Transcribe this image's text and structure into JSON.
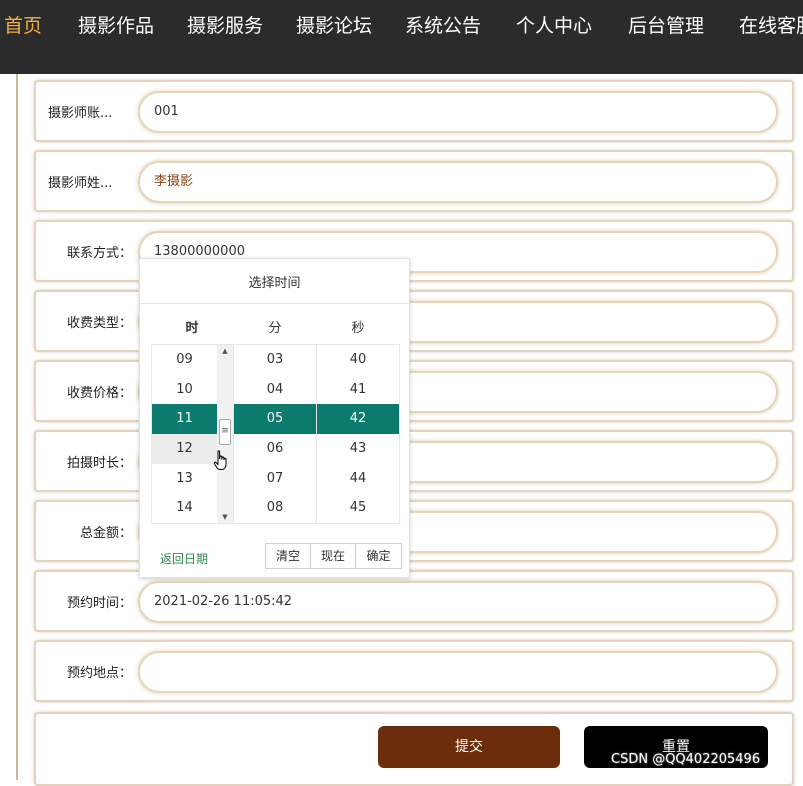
{
  "nav": {
    "items": [
      "首页",
      "摄影作品",
      "摄影服务",
      "摄影论坛",
      "系统公告",
      "个人中心",
      "后台管理",
      "在线客服"
    ],
    "active_color": "#f5b041"
  },
  "form": {
    "rows": [
      {
        "label": "摄影师账...",
        "value": ""
      },
      {
        "label": "摄影师姓...",
        "value": ""
      },
      {
        "label": "联系方式：",
        "value": ""
      },
      {
        "label": "收费类型：",
        "value": ""
      },
      {
        "label": "收费价格：",
        "value": ""
      },
      {
        "label": "拍摄时长：",
        "value": ""
      },
      {
        "label": "总金额：",
        "value": ""
      },
      {
        "label": "预约时间：",
        "value": ""
      },
      {
        "label": "预约地点：",
        "value": ""
      }
    ],
    "account_value": "001",
    "name_value": "李摄影",
    "phone_value": "13800000000",
    "appointment_value": "2021-02-26 11:05:42",
    "submit_label": "提交",
    "reset_label": "重置"
  },
  "picker": {
    "title": "选择时间",
    "headers": {
      "hour": "时",
      "minute": "分",
      "second": "秒"
    },
    "hours": [
      "09",
      "10",
      "11",
      "12",
      "13",
      "14"
    ],
    "minutes": [
      "03",
      "04",
      "05",
      "06",
      "07",
      "08"
    ],
    "seconds": [
      "40",
      "41",
      "42",
      "43",
      "44",
      "45"
    ],
    "selected": {
      "hour": "11",
      "minute": "05",
      "second": "42"
    },
    "back_to_date": "返回日期",
    "clear_label": "清空",
    "now_label": "现在",
    "confirm_label": "确定",
    "accent_color": "#0d7a6e"
  },
  "watermark": "CSDN @QQ402205496"
}
